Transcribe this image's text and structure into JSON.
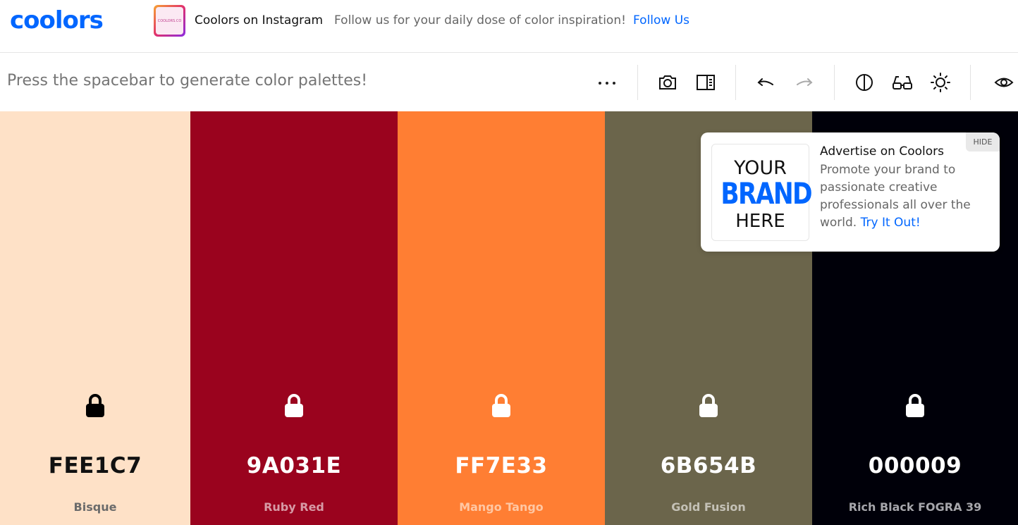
{
  "header": {
    "logo": "coolors",
    "instagram_thumb_text": "COOLORS.CO",
    "instagram_title": "Coolors on Instagram",
    "instagram_subtitle": "Follow us for your daily dose of color inspiration!",
    "follow_link": "Follow Us"
  },
  "toolbar": {
    "hint": "Press the spacebar to generate color palettes!",
    "icons": [
      "more-icon",
      "camera-icon",
      "side-panel-icon",
      "undo-icon",
      "redo-icon",
      "contrast-icon",
      "glasses-icon",
      "sun-icon",
      "eye-icon"
    ]
  },
  "palette": [
    {
      "hex": "FEE1C7",
      "name": "Bisque",
      "color": "#FEE1C7",
      "text_color": "#111111",
      "name_color": "#6b6b6b",
      "lock_color": "#000000"
    },
    {
      "hex": "9A031E",
      "name": "Ruby Red",
      "color": "#9A031E",
      "text_color": "#ffffff",
      "name_color": "#d79aa5",
      "lock_color": "#ffffff"
    },
    {
      "hex": "FF7E33",
      "name": "Mango Tango",
      "color": "#FF7E33",
      "text_color": "#ffffff",
      "name_color": "#ffc7a3",
      "lock_color": "#ffffff"
    },
    {
      "hex": "6B654B",
      "name": "Gold Fusion",
      "color": "#6B654B",
      "text_color": "#ffffff",
      "name_color": "#c4c1b6",
      "lock_color": "#ffffff"
    },
    {
      "hex": "000009",
      "name": "Rich Black FOGRA 39",
      "color": "#000009",
      "text_color": "#ffffff",
      "name_color": "#a6a6ab",
      "lock_color": "#ffffff"
    }
  ],
  "ad": {
    "hide": "HIDE",
    "image_your": "YOUR",
    "image_brand": "BRAND",
    "image_here": "HERE",
    "title": "Advertise on Coolors",
    "body": "Promote your brand to passionate creative professionals all over the world.",
    "link": "Try It Out!"
  },
  "colors": {
    "accent": "#0066ff"
  }
}
